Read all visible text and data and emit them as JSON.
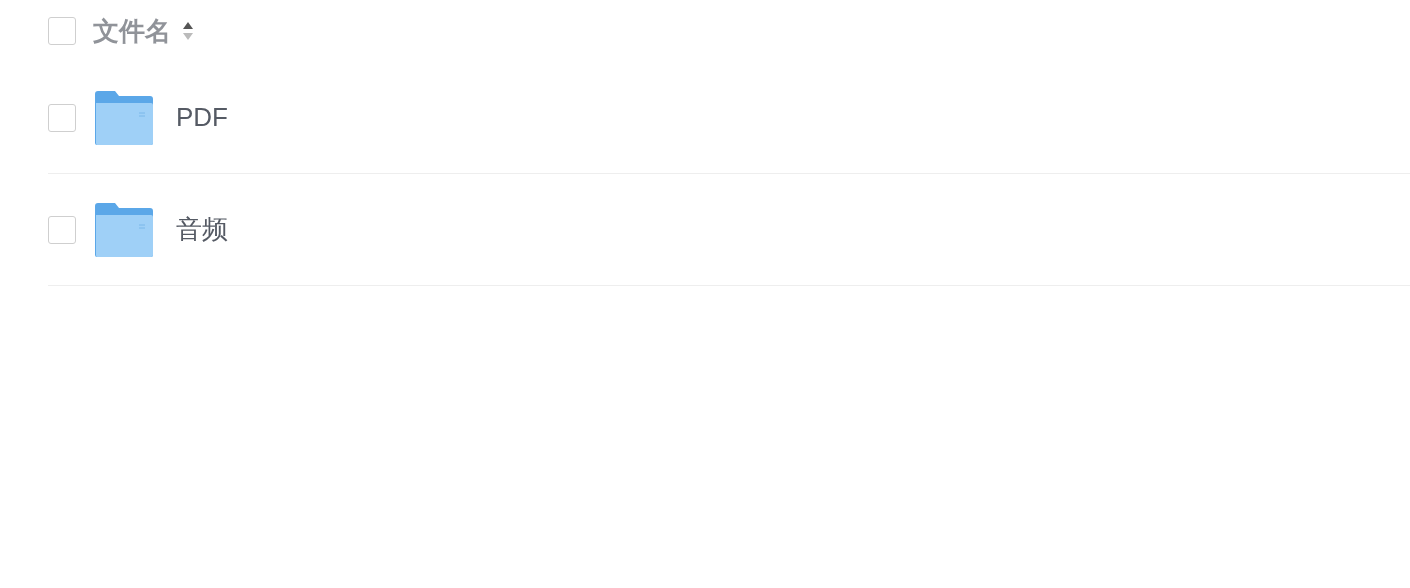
{
  "header": {
    "checked": false,
    "label": "文件名",
    "sort_ascending": true
  },
  "files": [
    {
      "kind": "folder",
      "name": "PDF",
      "checked": false
    },
    {
      "kind": "folder",
      "name": "音频",
      "checked": false
    }
  ]
}
